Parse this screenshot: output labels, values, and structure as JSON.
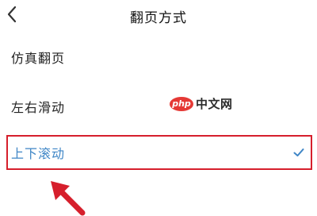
{
  "header": {
    "title": "翻页方式",
    "back_icon": "chevron-left-icon"
  },
  "options": [
    {
      "label": "仿真翻页",
      "selected": false
    },
    {
      "label": "左右滑动",
      "selected": false
    },
    {
      "label": "上下滚动",
      "selected": true
    }
  ],
  "watermark": {
    "logo": "php",
    "text": "中文网"
  },
  "colors": {
    "selected_text": "#3f86c6",
    "check_mark": "#3f86c6",
    "highlight_border": "#d61f2c",
    "arrow": "#d61f2c"
  }
}
